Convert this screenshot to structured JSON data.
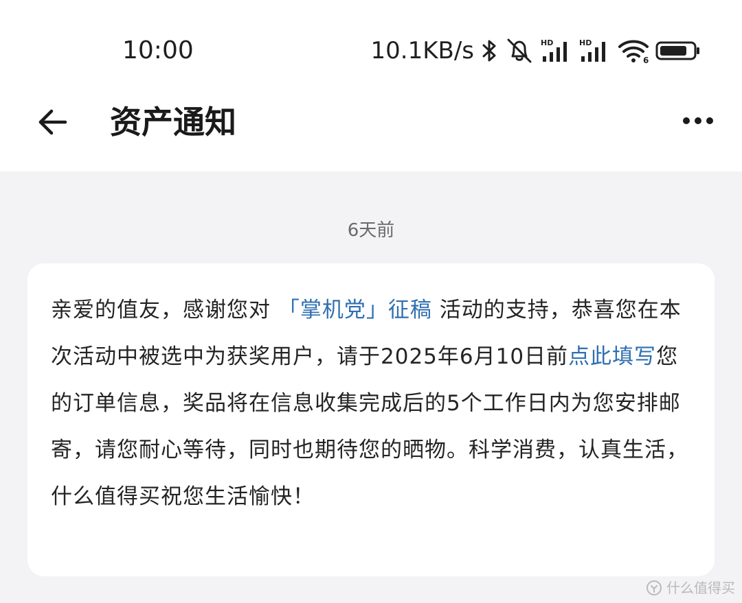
{
  "status_bar": {
    "time": "10:00",
    "net_speed": "10.1KB/s",
    "icons": [
      "bluetooth-icon",
      "mute-icon",
      "signal-hd-icon",
      "signal-hd-icon",
      "wifi-icon",
      "battery-icon"
    ],
    "hd_label": "HD",
    "wifi_label": "6"
  },
  "nav": {
    "title": "资产通知",
    "back_icon": "arrow-left-icon",
    "more_icon": "more-dots-icon"
  },
  "message": {
    "time": "6天前",
    "text_1": "亲爱的值友，感谢您对 ",
    "activity_link": "「掌机党」征稿",
    "text_2": " 活动的支持，恭喜您在本次活动中被选中为获奖用户，请于2025年6月10日前",
    "fill_link": "点此填写",
    "text_3": "您的订单信息，奖品将在信息收集完成后的5个工作日内为您安排邮寄，请您耐心等待，同时也期待您的晒物。科学消费，认真生活，什么值得买祝您生活愉快！"
  },
  "watermark": {
    "text": "什么值得买"
  },
  "colors": {
    "link": "#2f6fb1",
    "background": "#f3f3f5",
    "card": "#ffffff"
  }
}
